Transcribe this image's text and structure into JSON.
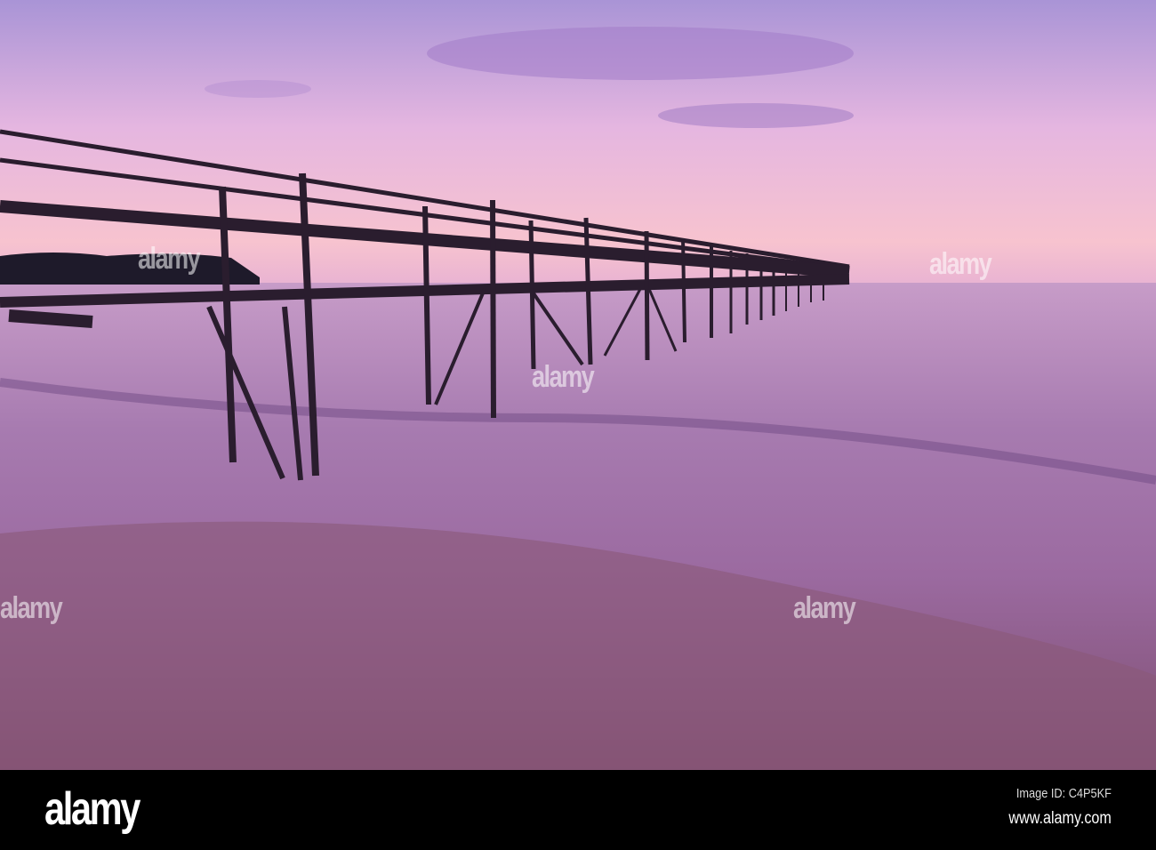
{
  "photo": {
    "subject": "pier-at-sunset"
  },
  "watermark": {
    "text": "alamy"
  },
  "footer": {
    "logo": "alamy",
    "image_id": "Image ID: C4P5KF",
    "website": "www.alamy.com"
  },
  "colors": {
    "sky_top": "#b49ad6",
    "sky_horizon": "#f3b6c8",
    "water": "#9a6fa6",
    "sand": "#8a5878"
  }
}
